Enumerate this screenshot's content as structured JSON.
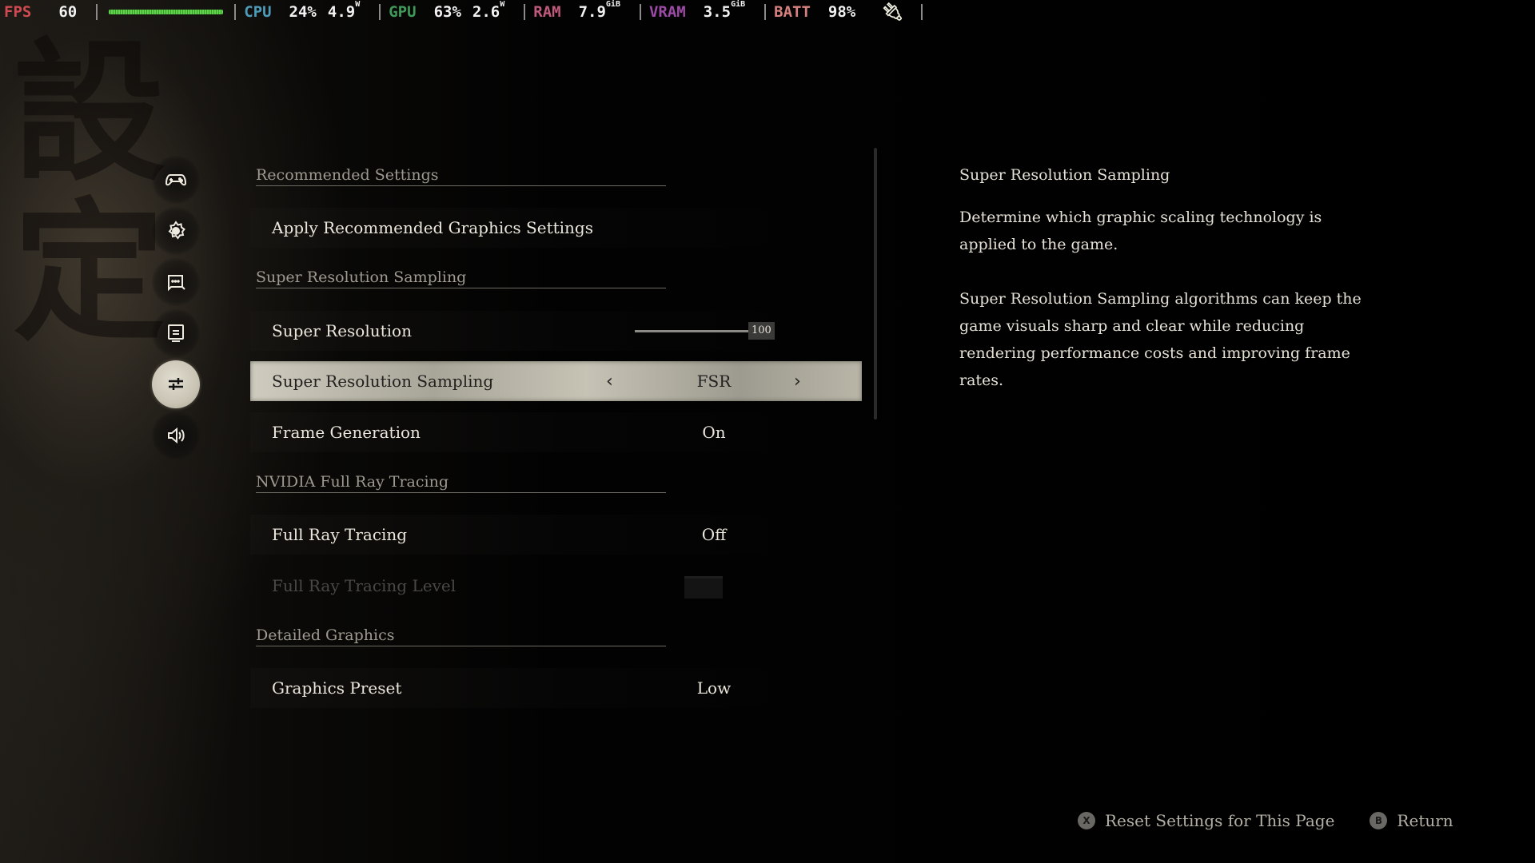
{
  "overlay": {
    "fps": {
      "label": "FPS",
      "value": "60"
    },
    "cpu": {
      "label": "CPU",
      "usage": "24%",
      "power": "4.9",
      "power_unit": "W"
    },
    "gpu": {
      "label": "GPU",
      "usage": "63%",
      "power": "2.6",
      "power_unit": "W"
    },
    "ram": {
      "label": "RAM",
      "value": "7.9",
      "unit": "GiB"
    },
    "vram": {
      "label": "VRAM",
      "value": "3.5",
      "unit": "GiB"
    },
    "batt": {
      "label": "BATT",
      "value": "98%"
    },
    "charging_icon": "plug-icon"
  },
  "background": {
    "calligraphy": "設定"
  },
  "sidebar": {
    "items": [
      {
        "icon": "gamepad-icon",
        "name": "controls"
      },
      {
        "icon": "gear-icon",
        "name": "general"
      },
      {
        "icon": "chat-icon",
        "name": "interface"
      },
      {
        "icon": "monitor-icon",
        "name": "display"
      },
      {
        "icon": "sliders-icon",
        "name": "graphics",
        "active": true
      },
      {
        "icon": "speaker-icon",
        "name": "audio"
      }
    ]
  },
  "settings": {
    "sections": [
      {
        "title": "Recommended Settings"
      },
      {
        "title": "Super Resolution Sampling"
      },
      {
        "title": "NVIDIA Full Ray Tracing"
      },
      {
        "title": "Detailed Graphics"
      }
    ],
    "rows": {
      "apply_recommended": {
        "label": "Apply Recommended Graphics Settings"
      },
      "super_resolution": {
        "label": "Super Resolution",
        "value": "100",
        "percent": 100
      },
      "super_resolution_sampling": {
        "label": "Super Resolution Sampling",
        "value": "FSR",
        "selected": true,
        "prev": "‹",
        "next": "›"
      },
      "frame_generation": {
        "label": "Frame Generation",
        "value": "On"
      },
      "full_ray_tracing": {
        "label": "Full Ray Tracing",
        "value": "Off"
      },
      "full_ray_tracing_level": {
        "label": "Full Ray Tracing Level",
        "disabled": true
      },
      "graphics_preset": {
        "label": "Graphics Preset",
        "value": "Low"
      }
    }
  },
  "description": {
    "title": "Super Resolution Sampling",
    "paragraphs": [
      "Determine which graphic scaling technology is applied to the game.",
      "Super Resolution Sampling algorithms can keep the game visuals sharp and clear while reducing rendering performance costs and improving frame rates."
    ]
  },
  "footer": {
    "reset": {
      "button": "X",
      "label": "Reset Settings for This Page"
    },
    "return": {
      "button": "B",
      "label": "Return"
    }
  }
}
